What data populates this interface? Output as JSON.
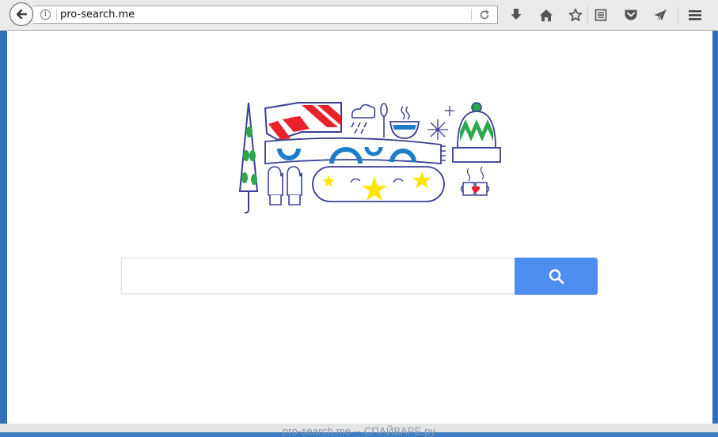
{
  "browser": {
    "url": "pro-search.me",
    "icons": {
      "back": "back-arrow-icon",
      "info": "info-icon",
      "reload": "reload-icon",
      "download": "download-icon",
      "home": "home-icon",
      "bookmark": "star-icon",
      "reader": "reader-list-icon",
      "pocket": "pocket-icon",
      "send": "send-arrow-icon",
      "menu": "hamburger-menu-icon"
    }
  },
  "page": {
    "search_placeholder": "",
    "search_icon": "magnifier-icon",
    "accent_color": "#4d8ef0"
  },
  "watermark": "pro-search.me -- СПАЙВАРЕ.ру"
}
